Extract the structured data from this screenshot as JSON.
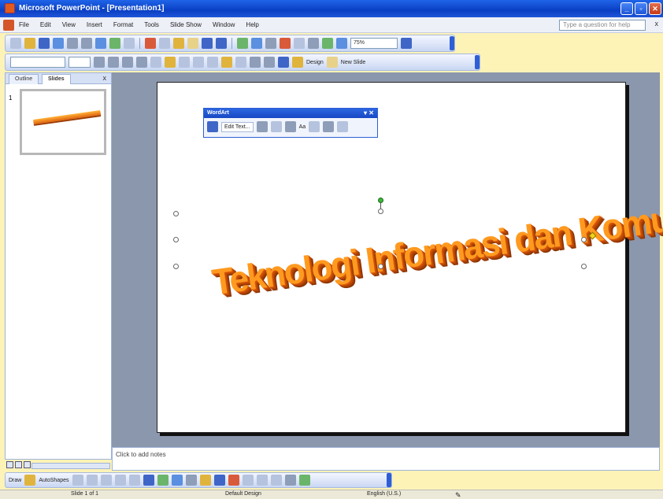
{
  "window": {
    "title": "Microsoft PowerPoint - [Presentation1]"
  },
  "menu": {
    "items": [
      "File",
      "Edit",
      "View",
      "Insert",
      "Format",
      "Tools",
      "Slide Show",
      "Window",
      "Help"
    ],
    "ask_placeholder": "Type a question for help",
    "close_glyph": "x"
  },
  "toolbar": {
    "zoom": "75%",
    "design_label": "Design",
    "new_slide_label": "New Slide"
  },
  "left_pane": {
    "tabs": [
      "Outline",
      "Slides"
    ],
    "close_glyph": "x",
    "slide_number": "1"
  },
  "wordart_toolbar": {
    "title": "WordArt",
    "edit_text_label": "Edit Text...",
    "aa_label": "Aa"
  },
  "slide": {
    "wordart_text": "Teknologi Informasi dan Komunikasi"
  },
  "notes": {
    "placeholder": "Click to add notes"
  },
  "drawing_toolbar": {
    "draw_label": "Draw",
    "autoshapes_label": "AutoShapes"
  },
  "status": {
    "slide": "Slide 1 of 1",
    "design": "Default Design",
    "language": "English (U.S.)"
  },
  "colors": {
    "title_bar": "#0a3fc4",
    "wordart_face": "#ff9a1f",
    "wordart_extrusion": "#9c3a02",
    "slide_area": "#8b97ac"
  }
}
